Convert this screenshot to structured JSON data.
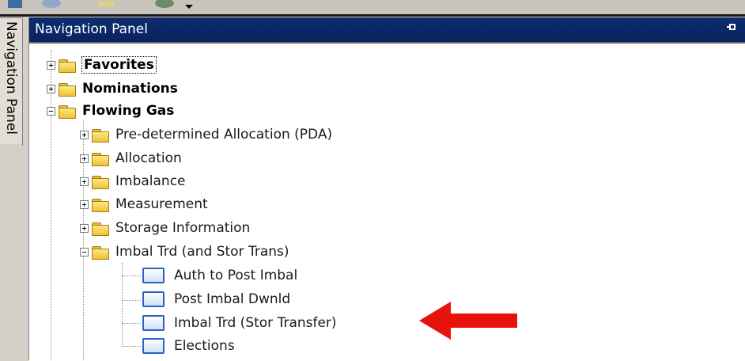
{
  "panel": {
    "title": "Navigation Panel",
    "pin_icon": "pin-icon",
    "side_tab_label": "Navigation Panel"
  },
  "tree": {
    "roots": [
      {
        "label": "Favorites",
        "state": "collapsed"
      },
      {
        "label": "Nominations",
        "state": "collapsed"
      },
      {
        "label": "Flowing Gas",
        "state": "expanded"
      }
    ],
    "flowing_gas_children": [
      {
        "label": "Pre-determined Allocation (PDA)",
        "state": "collapsed"
      },
      {
        "label": "Allocation",
        "state": "collapsed"
      },
      {
        "label": "Imbalance",
        "state": "collapsed"
      },
      {
        "label": "Measurement",
        "state": "collapsed"
      },
      {
        "label": "Storage Information",
        "state": "collapsed"
      },
      {
        "label": "Imbal Trd (and Stor Trans)",
        "state": "expanded"
      }
    ],
    "imbal_trd_children": [
      {
        "label": "Auth to Post Imbal"
      },
      {
        "label": "Post Imbal Dwnld"
      },
      {
        "label": "Imbal Trd (Stor Transfer)"
      },
      {
        "label": "Elections"
      }
    ]
  },
  "annotation": {
    "arrow_color": "#e8120c",
    "points_to": "Imbal Trd (Stor Transfer)"
  }
}
